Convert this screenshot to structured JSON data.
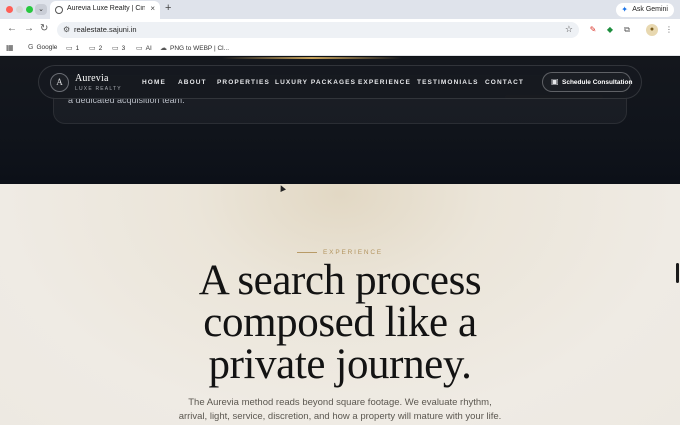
{
  "browser": {
    "tab_title": "Aurevia Luxe Realty | Cinem",
    "tab_menu_glyph": "⌄",
    "new_tab_glyph": "+",
    "close_glyph": "×",
    "ask_gemini": "Ask Gemini",
    "url": "realestate.sajuni.in",
    "bookmarks": [
      {
        "label": "Google",
        "icon": "google-icon"
      },
      {
        "label": "1",
        "icon": "folder-icon"
      },
      {
        "label": "2",
        "icon": "folder-icon"
      },
      {
        "label": "3",
        "icon": "folder-icon"
      },
      {
        "label": "AI",
        "icon": "folder-icon"
      },
      {
        "label": "PNG to WEBP | Cl...",
        "icon": "cloud-icon"
      }
    ]
  },
  "prev_section": {
    "text": "a dedicated acquisition team."
  },
  "navbar": {
    "logo_letter": "A",
    "brand": "Aurevia",
    "brand_sub": "LUXE REALTY",
    "items": [
      "HOME",
      "ABOUT",
      "PROPERTIES",
      "LUXURY PACKAGES",
      "EXPERIENCE",
      "TESTIMONIALS",
      "CONTACT"
    ],
    "cta": "Schedule Consultation"
  },
  "experience": {
    "eyebrow": "EXPERIENCE",
    "headline_lines": [
      "A search process",
      "composed like a",
      "private journey."
    ],
    "body_lines": [
      "The Aurevia method reads beyond square footage. We evaluate rhythm,",
      "arrival, light, service, discretion, and how a property will mature with your life."
    ]
  },
  "colors": {
    "gold": "#c6a25c",
    "dark_bg": "#10141b",
    "light_bg": "#ede9e2",
    "headline": "#131313"
  }
}
